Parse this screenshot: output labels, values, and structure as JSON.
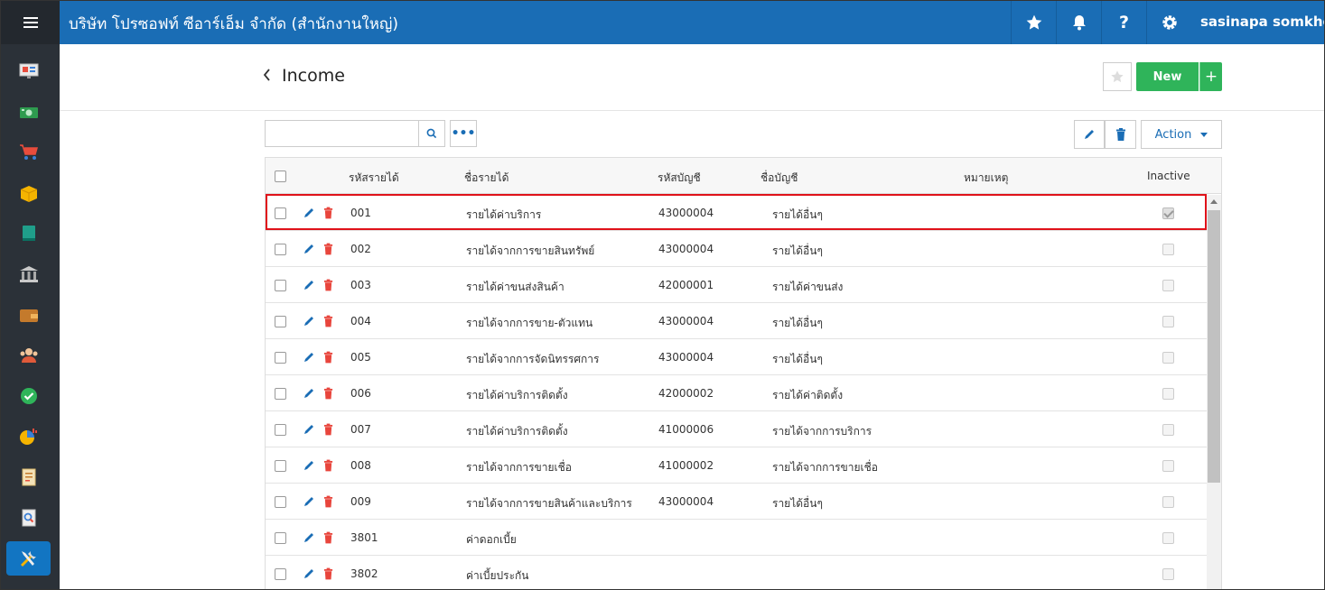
{
  "topbar": {
    "company": "บริษัท โปรซอฟท์ ซีอาร์เอ็ม จำกัด (สำนักงานใหญ่)",
    "user": "sasinapa somkho...",
    "accent": "#1a6db5"
  },
  "sidebar": {
    "icons": [
      "menu-icon",
      "dashboard-icon",
      "money-icon",
      "cart-icon",
      "box-icon",
      "book-icon",
      "bank-icon",
      "wallet-icon",
      "people-icon",
      "check-icon",
      "pie-chart-icon",
      "report-icon",
      "search-doc-icon",
      "tools-icon"
    ]
  },
  "header": {
    "title": "Income",
    "new_label": "New",
    "plus_label": "+"
  },
  "toolbar": {
    "search_value": "",
    "more_label": "•••",
    "action_label": "Action"
  },
  "table": {
    "columns": [
      "รหัสรายได้",
      "ชื่อรายได้",
      "รหัสบัญชี",
      "ชื่อบัญชี",
      "หมายเหตุ",
      "Inactive"
    ],
    "rows": [
      {
        "code": "001",
        "name": "รายได้ค่าบริการ",
        "account_code": "43000004",
        "account_name": "รายได้อื่นๆ",
        "note": "",
        "inactive": true
      },
      {
        "code": "002",
        "name": "รายได้จากการขายสินทรัพย์",
        "account_code": "43000004",
        "account_name": "รายได้อื่นๆ",
        "note": "",
        "inactive": false
      },
      {
        "code": "003",
        "name": "รายได้ค่าขนส่งสินค้า",
        "account_code": "42000001",
        "account_name": "รายได้ค่าขนส่ง",
        "note": "",
        "inactive": false
      },
      {
        "code": "004",
        "name": "รายได้จากการขาย-ตัวแทน",
        "account_code": "43000004",
        "account_name": "รายได้อื่นๆ",
        "note": "",
        "inactive": false
      },
      {
        "code": "005",
        "name": "รายได้จากการจัดนิทรรศการ",
        "account_code": "43000004",
        "account_name": "รายได้อื่นๆ",
        "note": "",
        "inactive": false
      },
      {
        "code": "006",
        "name": "รายได้ค่าบริการติดตั้ง",
        "account_code": "42000002",
        "account_name": "รายได้ค่าติดตั้ง",
        "note": "",
        "inactive": false
      },
      {
        "code": "007",
        "name": "รายได้ค่าบริการติดตั้ง",
        "account_code": "41000006",
        "account_name": "รายได้จากการบริการ",
        "note": "",
        "inactive": false
      },
      {
        "code": "008",
        "name": "รายได้จากการขายเชื่อ",
        "account_code": "41000002",
        "account_name": "รายได้จากการขายเชื่อ",
        "note": "",
        "inactive": false
      },
      {
        "code": "009",
        "name": "รายได้จากการขายสินค้าและบริการ",
        "account_code": "43000004",
        "account_name": "รายได้อื่นๆ",
        "note": "",
        "inactive": false
      },
      {
        "code": "3801",
        "name": "ค่าดอกเบี้ย",
        "account_code": "",
        "account_name": "",
        "note": "",
        "inactive": false
      },
      {
        "code": "3802",
        "name": "ค่าเบี้ยประกัน",
        "account_code": "",
        "account_name": "",
        "note": "",
        "inactive": false
      }
    ]
  }
}
